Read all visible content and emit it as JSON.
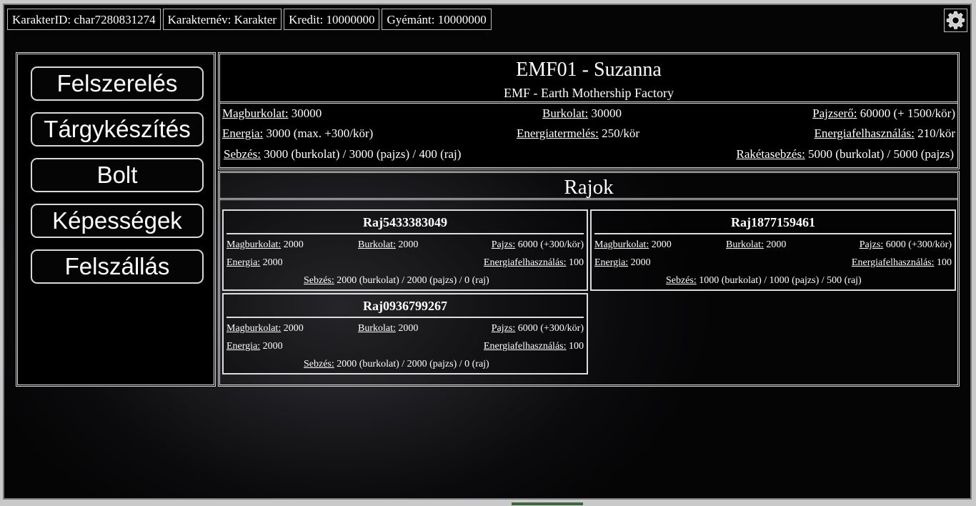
{
  "topbar": {
    "character_id": "KarakterID: char7280831274",
    "character_name": "Karakternév: Karakter",
    "credit": "Kredit: 10000000",
    "diamond": "Gyémánt: 10000000",
    "settings_icon": "gear-icon"
  },
  "menu": [
    {
      "label": "Felszerelés"
    },
    {
      "label": "Tárgykészítés"
    },
    {
      "label": "Bolt"
    },
    {
      "label": "Képességek"
    },
    {
      "label": "Felszállás"
    }
  ],
  "ship": {
    "title": "EMF01 - Suzanna",
    "subtitle": "EMF - Earth Mothership Factory",
    "stats": {
      "core_label": "Magburkolat:",
      "core_value": " 30000",
      "hull_label": "Burkolat:",
      "hull_value": " 30000",
      "shield_label": "Pajzserő:",
      "shield_value": " 60000 (+ 1500/kör)",
      "energy_label": "Energia:",
      "energy_value": " 3000 (max. +300/kör)",
      "energy_gen_label": "Energiatermelés:",
      "energy_gen_value": " 250/kör",
      "energy_use_label": "Energiafelhasználás:",
      "energy_use_value": " 210/kör",
      "damage_label": "Sebzés:",
      "damage_value": " 3000 (burkolat) / 3000 (pajzs) / 400 (raj)",
      "rocket_label": "Rakétasebzés:",
      "rocket_value": " 5000 (burkolat) / 5000 (pajzs)"
    }
  },
  "swarms": {
    "header": "Rajok",
    "items": [
      {
        "name": "Raj5433383049",
        "core_label": "Magburkolat:",
        "core_value": " 2000",
        "hull_label": "Burkolat:",
        "hull_value": " 2000",
        "shield_label": "Pajzs:",
        "shield_value": " 6000 (+300/kör)",
        "energy_label": "Energia:",
        "energy_value": " 2000",
        "energy_use_label": "Energiafelhasználás:",
        "energy_use_value": " 100",
        "damage_label": "Sebzés:",
        "damage_value": " 2000 (burkolat) / 2000 (pajzs) / 0 (raj)"
      },
      {
        "name": "Raj1877159461",
        "core_label": "Magburkolat:",
        "core_value": " 2000",
        "hull_label": "Burkolat:",
        "hull_value": " 2000",
        "shield_label": "Pajzs:",
        "shield_value": " 6000 (+300/kör)",
        "energy_label": "Energia:",
        "energy_value": " 2000",
        "energy_use_label": "Energiafelhasználás:",
        "energy_use_value": " 100",
        "damage_label": "Sebzés:",
        "damage_value": " 1000 (burkolat) / 1000 (pajzs) / 500 (raj)"
      },
      {
        "name": "Raj0936799267",
        "core_label": "Magburkolat:",
        "core_value": " 2000",
        "hull_label": "Burkolat:",
        "hull_value": " 2000",
        "shield_label": "Pajzs:",
        "shield_value": " 6000 (+300/kör)",
        "energy_label": "Energia:",
        "energy_value": " 2000",
        "energy_use_label": "Energiafelhasználás:",
        "energy_use_value": " 100",
        "damage_label": "Sebzés:",
        "damage_value": " 2000 (burkolat) / 2000 (pajzs) / 0 (raj)"
      }
    ]
  }
}
